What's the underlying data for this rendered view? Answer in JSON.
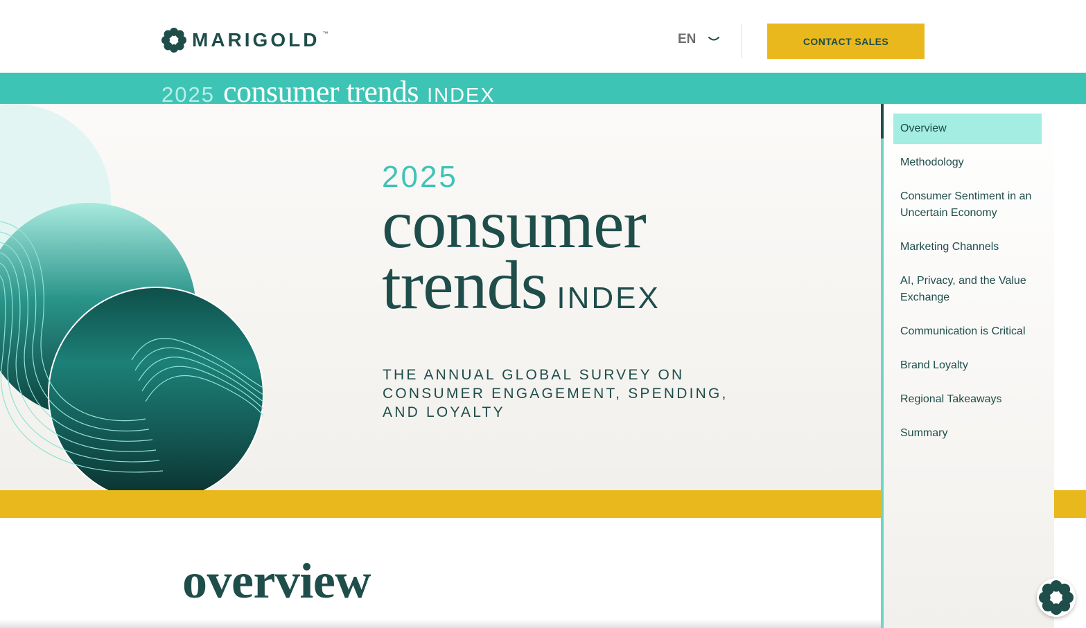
{
  "header": {
    "logo_text": "MARIGOLD",
    "logo_tm": "™",
    "language": "EN",
    "cta_label": "CONTACT SALES"
  },
  "banner": {
    "year": "2025",
    "title": "consumer trends",
    "index": "INDEX"
  },
  "hero": {
    "year": "2025",
    "title_line1": "consumer",
    "title_line2": "trends",
    "index": "INDEX",
    "subtitle": "THE ANNUAL GLOBAL SURVEY ON CONSUMER ENGAGEMENT, SPENDING, AND LOYALTY"
  },
  "section": {
    "heading": "overview"
  },
  "sidenav": {
    "items": [
      {
        "label": "Overview",
        "active": true
      },
      {
        "label": "Methodology"
      },
      {
        "label": "Consumer Sentiment in an Uncertain Economy"
      },
      {
        "label": "Marketing Channels"
      },
      {
        "label": "AI, Privacy, and the Value Exchange"
      },
      {
        "label": "Communication is Critical"
      },
      {
        "label": "Brand Loyalty"
      },
      {
        "label": "Regional Takeaways"
      },
      {
        "label": "Summary"
      }
    ]
  },
  "colors": {
    "brand_dark": "#1e4d4a",
    "teal": "#3ec4b5",
    "gold": "#e8b81d",
    "active_nav": "#a3ede2"
  },
  "icons": {
    "logo": "marigold-flower-icon",
    "language_toggle": "chevron-down-icon",
    "floating_button": "gear-icon"
  }
}
